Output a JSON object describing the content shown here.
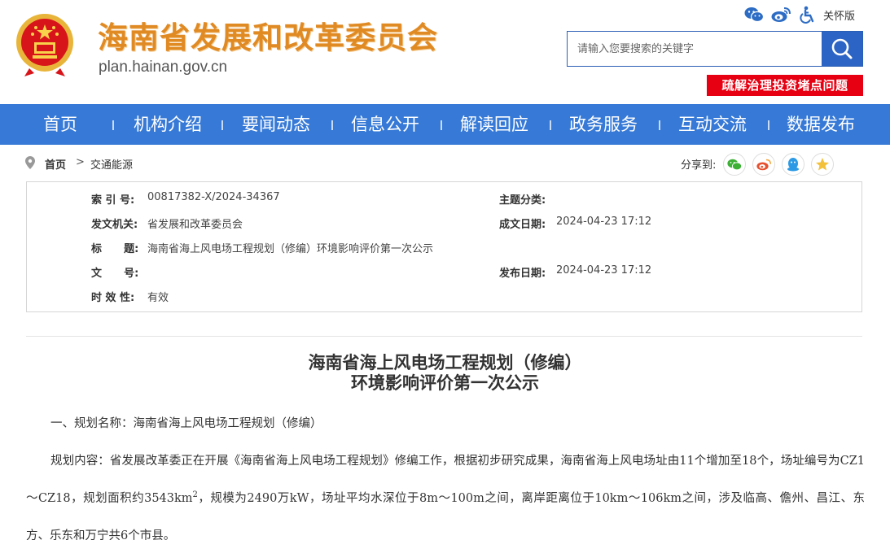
{
  "header": {
    "site_name": "海南省发展和改革委员会",
    "site_url": "plan.hainan.gov.cn",
    "care_mode": "关怀版",
    "search_placeholder": "请输入您要搜索的关键字",
    "promo": "疏解治理投资堵点问题"
  },
  "nav": {
    "items": [
      "首页",
      "机构介绍",
      "要闻动态",
      "信息公开",
      "解读回应",
      "政务服务",
      "互动交流",
      "数据发布"
    ]
  },
  "breadcrumb": {
    "home": "首页",
    "arrow": ">",
    "current": "交通能源",
    "share_label": "分享到:"
  },
  "meta": {
    "index_label": "索 引 号:",
    "index_value": "00817382-X/2024-34367",
    "topic_label": "主题分类:",
    "topic_value": "",
    "issuer_label": "发文机关:",
    "issuer_value": "省发展和改革委员会",
    "created_label": "成文日期:",
    "created_value": "2024-04-23 17:12",
    "title_label": "标      题:",
    "title_value": "海南省海上风电场工程规划（修编）环境影响评价第一次公示",
    "docno_label": "文      号:",
    "docno_value": "",
    "published_label": "发布日期:",
    "published_value": "2024-04-23 17:12",
    "validity_label": "时 效 性:",
    "validity_value": "有效"
  },
  "article": {
    "title_line1": "海南省海上风电场工程规划（修编）",
    "title_line2": "环境影响评价第一次公示",
    "section1": "一、规划名称：海南省海上风电场工程规划（修编）",
    "content_part1": "规划内容：省发展改革委正在开展《海南省海上风电场工程规划》修编工作，根据初步研究成果，海南省海上风电场址由11个增加至18个，场址编号为CZ1～CZ18，规划面积约3543km",
    "content_sup": "2",
    "content_part2": "，规模为2490万kW，场址平均水深位于8m～100m之间，离岸距离位于10km～106km之间，涉及临高、儋州、昌江、东方、乐东和万宁共6个市县。"
  },
  "colors": {
    "nav_bg": "#3679d6",
    "site_name": "#e08a24",
    "promo_bg": "#e60012",
    "search_btn": "#2b64c4"
  }
}
